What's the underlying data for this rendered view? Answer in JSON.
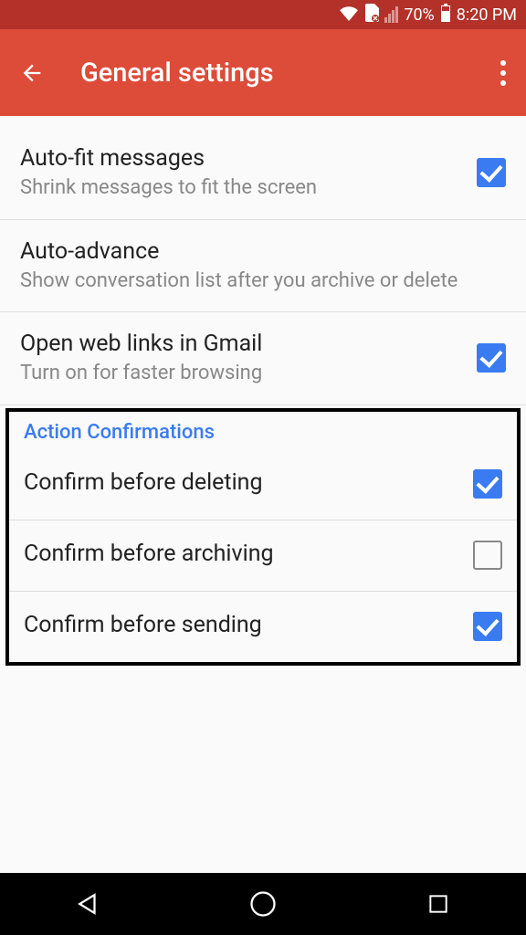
{
  "status": {
    "battery_pct": "70%",
    "time": "8:20 PM"
  },
  "header": {
    "title": "General settings"
  },
  "settings": [
    {
      "title": "Auto-fit messages",
      "sub": "Shrink messages to fit the screen",
      "checked": true,
      "has_check": true
    },
    {
      "title": "Auto-advance",
      "sub": "Show conversation list after you archive or delete",
      "has_check": false
    },
    {
      "title": "Open web links in Gmail",
      "sub": "Turn on for faster browsing",
      "checked": true,
      "has_check": true
    }
  ],
  "confirmations": {
    "header": "Action Confirmations",
    "items": [
      {
        "title": "Confirm before deleting",
        "checked": true
      },
      {
        "title": "Confirm before archiving",
        "checked": false
      },
      {
        "title": "Confirm before sending",
        "checked": true
      }
    ]
  }
}
